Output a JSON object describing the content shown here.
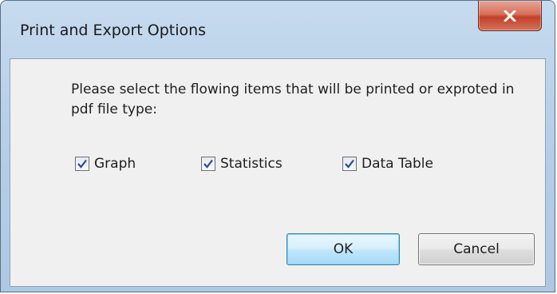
{
  "window": {
    "title": "Print and Export Options",
    "close_icon": "close-x-icon"
  },
  "dialog": {
    "message": "Please select the flowing items that will be printed or exproted in pdf file type:",
    "options": [
      {
        "label": "Graph",
        "checked": true
      },
      {
        "label": "Statistics",
        "checked": true
      },
      {
        "label": "Data Table",
        "checked": true
      }
    ],
    "buttons": {
      "ok_label": "OK",
      "cancel_label": "Cancel"
    }
  },
  "colors": {
    "title_bar": "#b7cfe8",
    "client_bg": "#f0f0f0",
    "close_button": "#c2412a",
    "default_button_border": "#3c7fb1",
    "check_mark": "#2a4d8f"
  }
}
